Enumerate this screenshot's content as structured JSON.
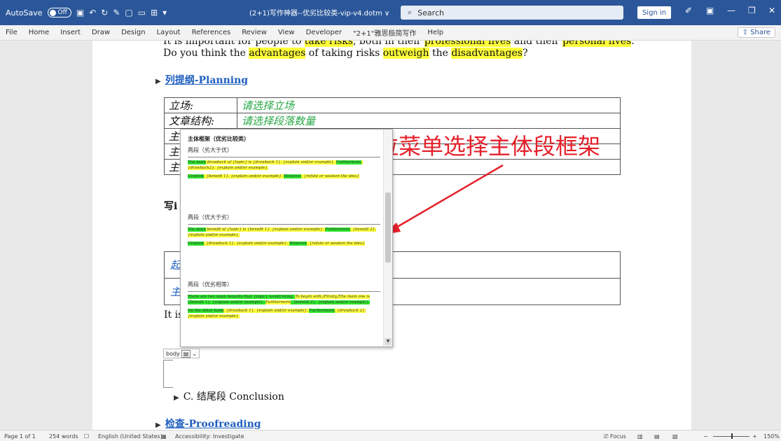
{
  "titlebar": {
    "autosave_label": "AutoSave",
    "autosave_state": "Off",
    "doc_title": "(2+1)写作神器--优劣比较类-vip-v4.dotm ∨",
    "search_placeholder": "Search",
    "signin_label": "Sign in",
    "accent_color": "#2b579a"
  },
  "menu": {
    "items": [
      "File",
      "Home",
      "Insert",
      "Draw",
      "Design",
      "Layout",
      "References",
      "Review",
      "View",
      "Developer",
      "\"2+1\"雅思极简写作",
      "Help"
    ],
    "share_label": "Share"
  },
  "document": {
    "line_top_parts": [
      "It is important for people to ",
      "take risks",
      ", both in their ",
      "professional lives",
      " and their ",
      "personal lives",
      "."
    ],
    "line_q_parts": [
      "Do you think the ",
      "advantages",
      " of taking risks ",
      "outweigh",
      " the ",
      "disadvantages",
      "?"
    ],
    "planning_heading": "列提纲-Planning",
    "plan_rows": [
      {
        "label": "立场:",
        "value": "请选择立场"
      },
      {
        "label": "文章结构:",
        "value": "请选择段落数量"
      },
      {
        "label": "主",
        "value": ""
      },
      {
        "label": "主",
        "value": ""
      },
      {
        "label": "主",
        "value": ""
      }
    ],
    "write_fragment": "写i",
    "table2_rows": [
      "起",
      "主"
    ],
    "it_is_fragment": "It is",
    "conclusion": "C.   结尾段 Conclusion",
    "proofreading_heading": "检查-Proofreading"
  },
  "dropdown": {
    "title": "主体框架（优劣比较类）",
    "sections": [
      {
        "head": "两段（劣大于优）",
        "p1": [
          "The main",
          " drawback of {topic} is {drawback 1}. {explain and/or example}. ",
          "Furthermore",
          ", {drawback2}. {explain and/or example}."
        ],
        "p2": [
          "Granted",
          ", {benefit 1}. {explain and/or example}. ",
          "However",
          ", {refute or weaken the idea}"
        ]
      },
      {
        "head": "两段（优大于劣）",
        "p1": [
          "The main",
          " benefit of {topic} is {benefit 1}. {explain and/or example}. ",
          "Furthermore",
          ", {benefit 2}. {explain and/or example}."
        ],
        "p2": [
          "Granted",
          ", {drawback 1}. {explain and/or example}. ",
          "However",
          ", {refute or weaken the idea}"
        ]
      },
      {
        "head": "两段（优劣相等）",
        "p1": [
          "There are two main benefits that {topic} would bring. ",
          "To begin with,/Firstly,/The main one is",
          " {benefit 1}. {explain and/or example}. ",
          "Furthermore",
          ", {benefit 2}. {explain and/or example}."
        ],
        "p2": [
          "On the other hand",
          ", {drawback 1}. {explain and/or example}. ",
          "Furthermore",
          ", {drawback 2}. {explain and/or example}."
        ]
      }
    ]
  },
  "annotation": {
    "text": "下拉菜单选择主体段框架",
    "color": "#e5212b"
  },
  "body_selector": {
    "label": "body"
  },
  "status": {
    "page": "Page 1 of 1",
    "words": "254 words",
    "language": "English (United States)",
    "accessibility": "Accessibility: Investigate",
    "focus": "Focus",
    "zoom": "150%"
  }
}
